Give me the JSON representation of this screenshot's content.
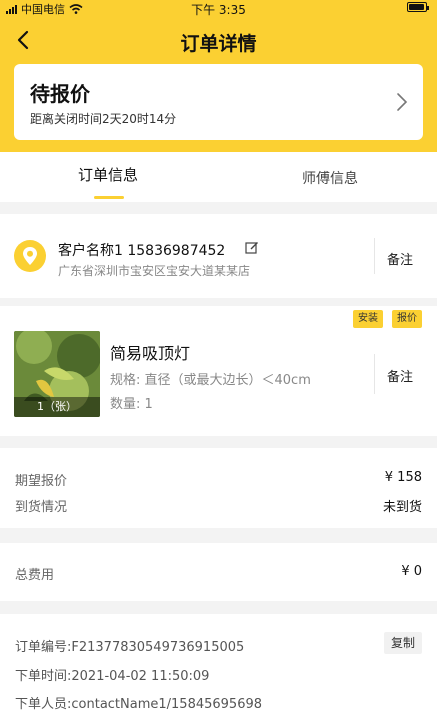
{
  "statusbar": {
    "carrier": "中国电信",
    "time": "下午 3:35"
  },
  "navbar": {
    "title": "订单详情"
  },
  "status_card": {
    "status": "待报价",
    "countdown": "距离关闭时间2天20时14分"
  },
  "tabs": [
    {
      "label": "订单信息",
      "active": true
    },
    {
      "label": "师傅信息",
      "active": false
    }
  ],
  "customer": {
    "name_phone": "客户名称1 15836987452",
    "address": "广东省深圳市宝安区宝安大道某某店",
    "note_label": "备注"
  },
  "product": {
    "tags": [
      "安装",
      "报价"
    ],
    "image_caption": "1（张）",
    "name": "简易吸顶灯",
    "spec": "规格: 直径（或最大边长）＜40cm",
    "quantity": "数量: 1",
    "note_label": "备注"
  },
  "quote": {
    "expected_label": "期望报价",
    "expected_value": "¥ 158",
    "arrival_label": "到货情况",
    "arrival_value": "未到货"
  },
  "fee": {
    "label": "总费用",
    "value": "¥ 0"
  },
  "order_info": {
    "order_no": "订单编号:F213778305497369150​05",
    "order_time": "下单时间:2021-04-02 11:50:09",
    "orderer": "下单人员:contactName1/15845695698",
    "copy_label": "复制"
  },
  "colors": {
    "accent": "#fbd032",
    "background": "#f3f3f3"
  }
}
